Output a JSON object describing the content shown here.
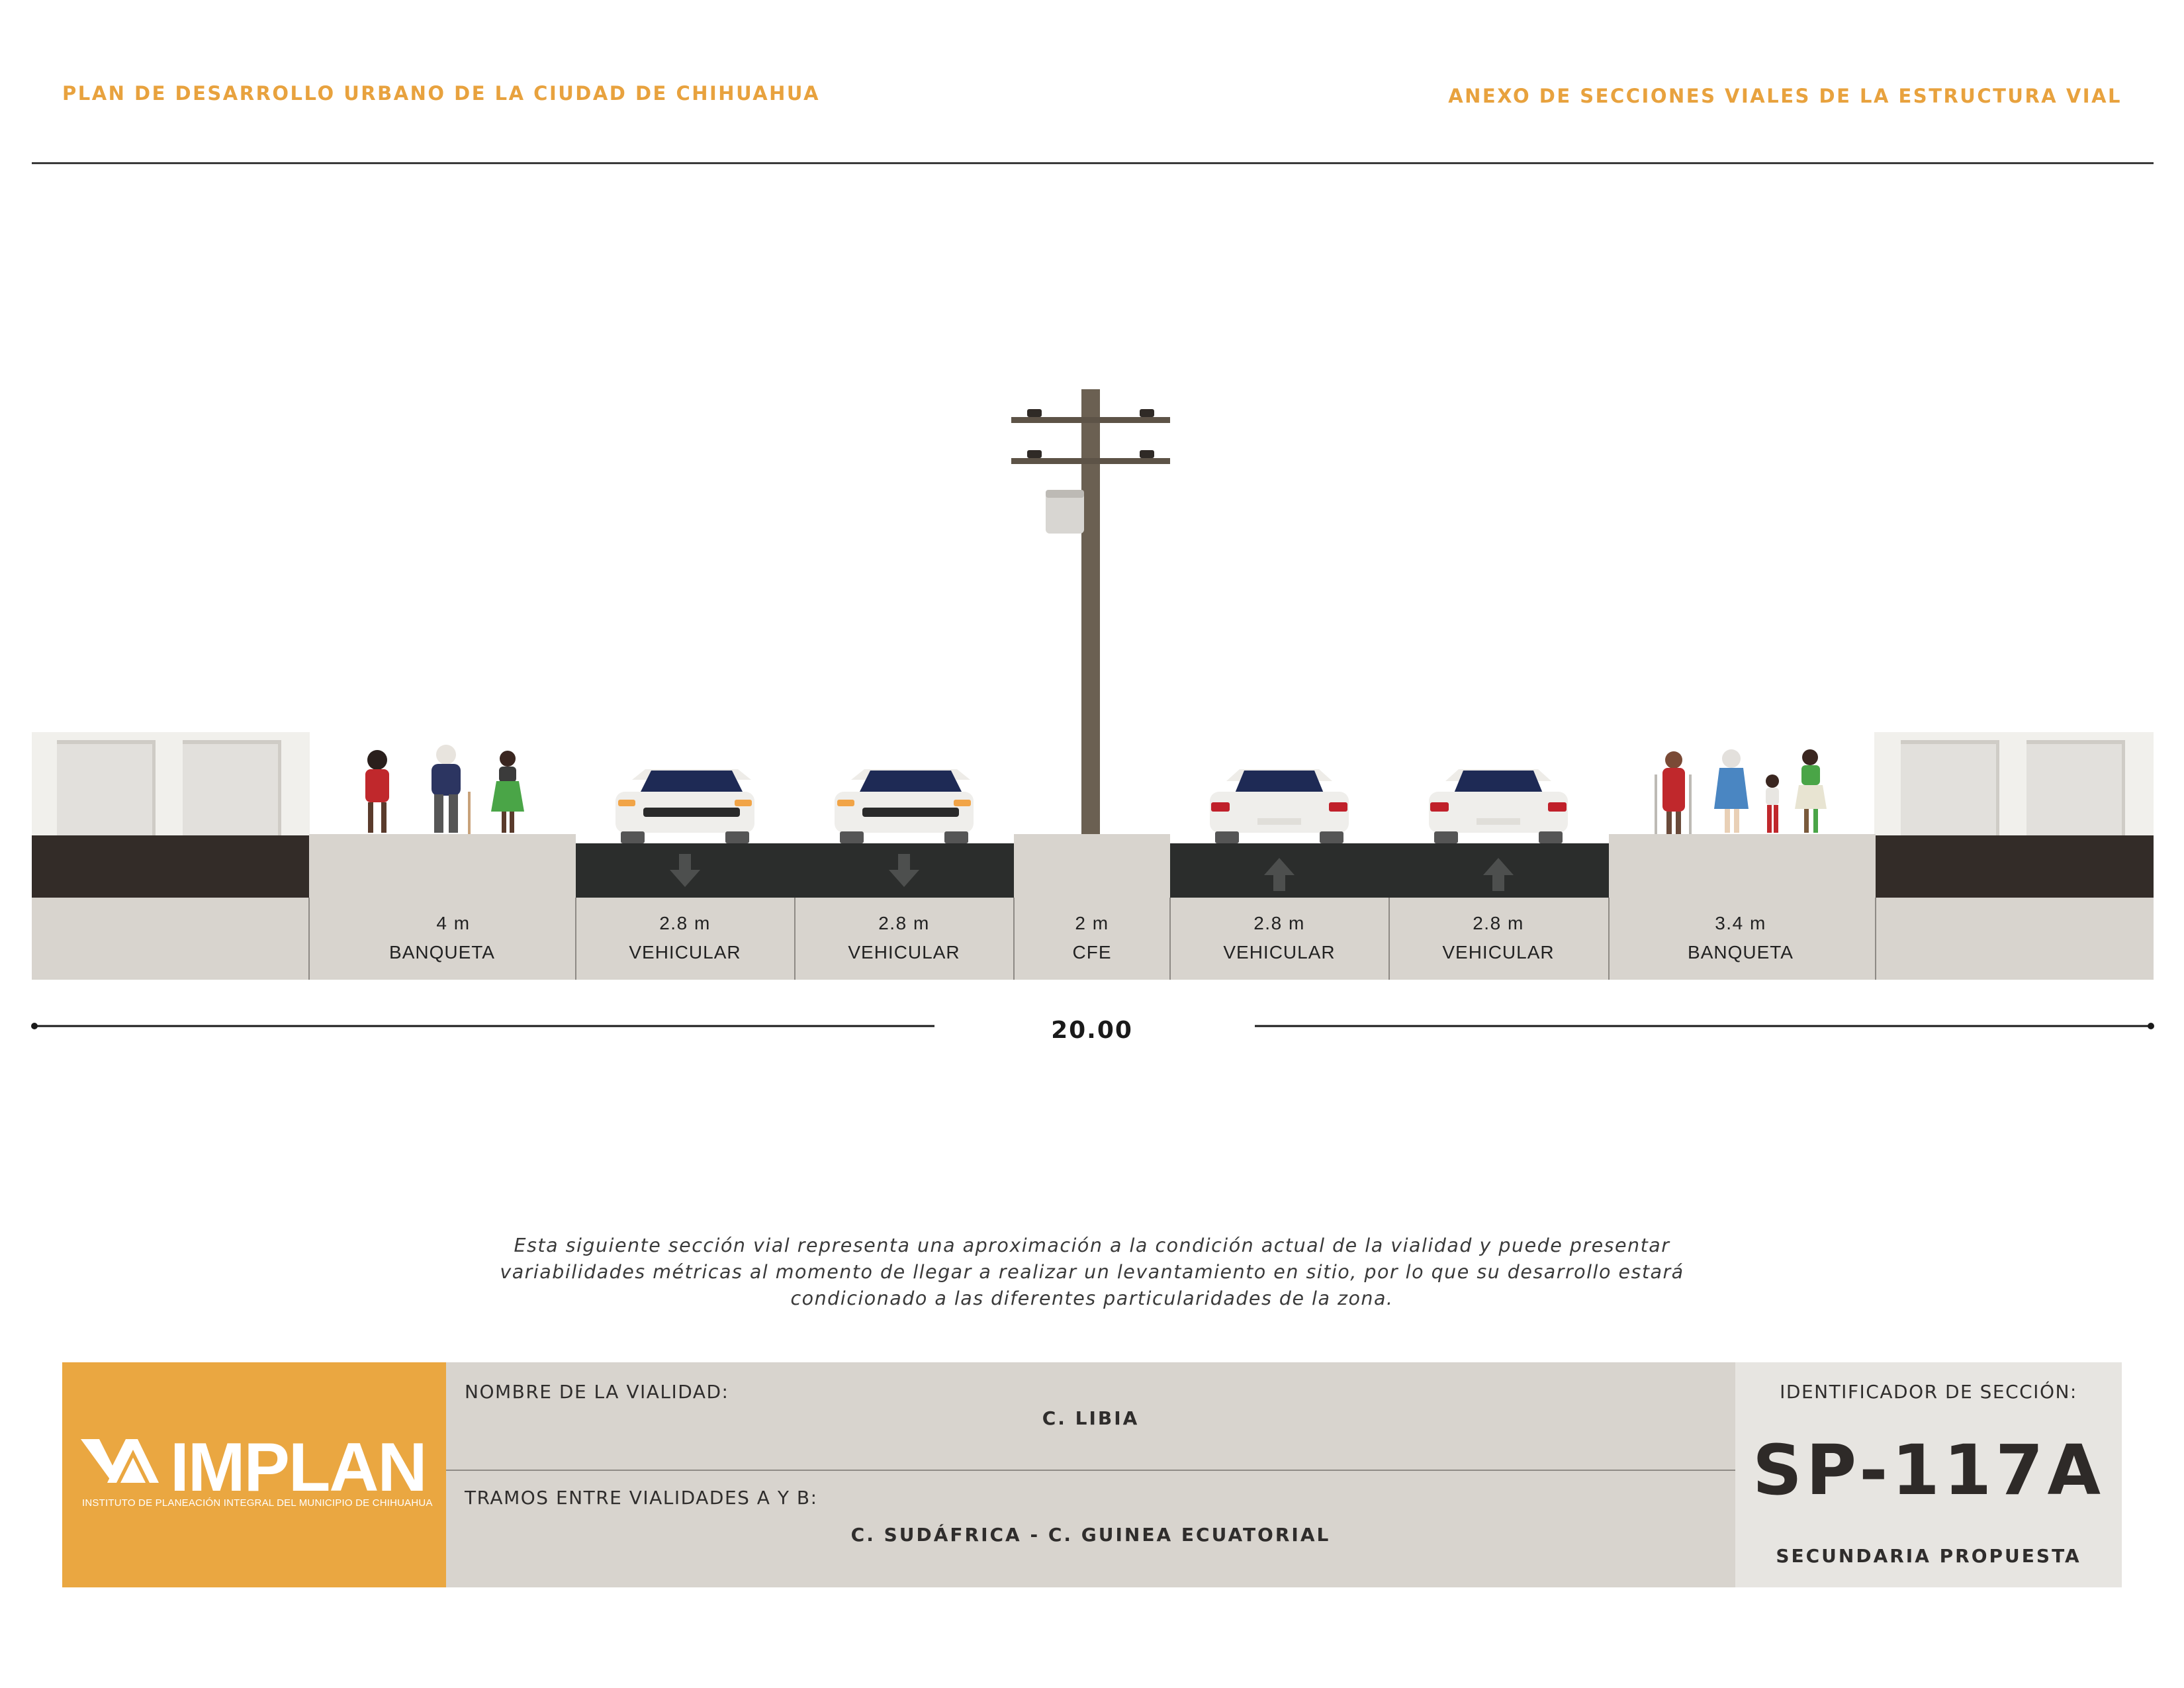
{
  "header": {
    "left_title": "PLAN DE DESARROLLO URBANO DE LA CIUDAD DE CHIHUAHUA",
    "right_title": "ANEXO DE SECCIONES VIALES DE LA ESTRUCTURA VIAL"
  },
  "section": {
    "segments": [
      {
        "width": "4 m",
        "label": "BANQUETA",
        "type": "sidewalk"
      },
      {
        "width": "2.8 m",
        "label": "VEHICULAR",
        "type": "lane",
        "direction": "down"
      },
      {
        "width": "2.8 m",
        "label": "VEHICULAR",
        "type": "lane",
        "direction": "down"
      },
      {
        "width": "2 m",
        "label": "CFE",
        "type": "median"
      },
      {
        "width": "2.8 m",
        "label": "VEHICULAR",
        "type": "lane",
        "direction": "up"
      },
      {
        "width": "2.8 m",
        "label": "VEHICULAR",
        "type": "lane",
        "direction": "up"
      },
      {
        "width": "3.4 m",
        "label": "BANQUETA",
        "type": "sidewalk"
      }
    ],
    "total_width": "20.00"
  },
  "disclaimer": {
    "line1": "Esta siguiente sección vial representa una aproximación a la condición actual de la vialidad y puede presentar",
    "line2": "variabilidades métricas al momento de llegar a realizar un levantamiento en sitio, por lo que su desarrollo estará",
    "line3": "condicionado a las diferentes particularidades de la zona."
  },
  "info": {
    "logo_text": "IMPLAN",
    "logo_subtitle": "INSTITUTO DE PLANEACIÓN INTEGRAL DEL MUNICIPIO DE CHIHUAHUA",
    "road_name_label": "NOMBRE DE LA VIALIDAD:",
    "road_name": "C. LIBIA",
    "segment_label": "TRAMOS ENTRE VIALIDADES A Y B:",
    "segment_value": "C. SUDÁFRICA - C. GUINEA ECUATORIAL",
    "id_label": "IDENTIFICADOR DE SECCIÓN:",
    "id_code": "SP-117A",
    "id_type": "SECUNDARIA PROPUESTA"
  },
  "colors": {
    "accent": "#eaa741",
    "asphalt": "#2b2d2c",
    "ground": "#d8d4ce",
    "pole": "#6b6052"
  }
}
